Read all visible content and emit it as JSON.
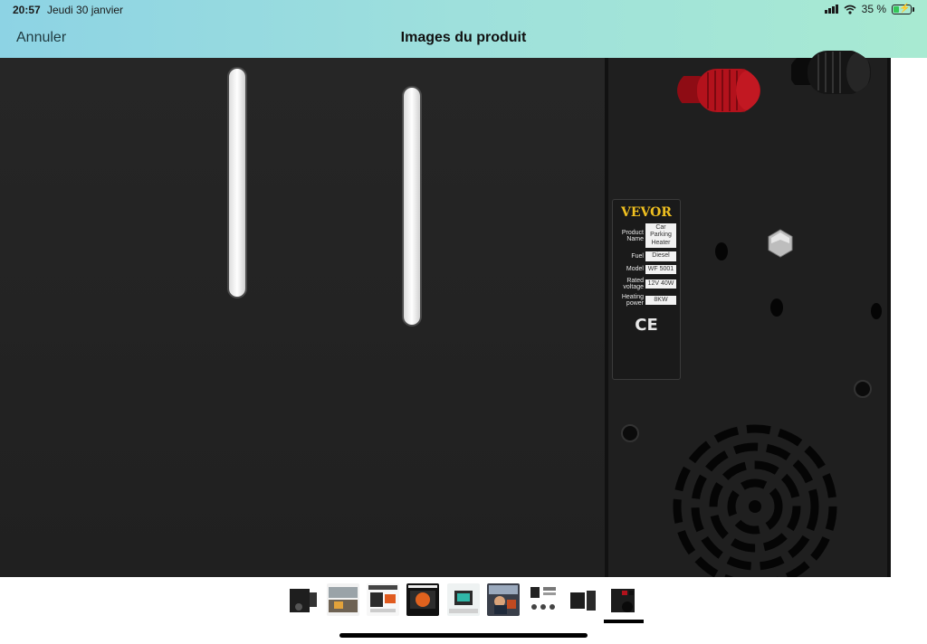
{
  "status_bar": {
    "time": "20:57",
    "date": "Jeudi 30 janvier",
    "battery": "35 %",
    "battery_level": 0.35
  },
  "nav": {
    "cancel_label": "Annuler",
    "title": "Images du produit"
  },
  "product_label": {
    "brand": "VEVOR",
    "specs": [
      {
        "key": "Product Name",
        "value": "Car Parking Heater"
      },
      {
        "key": "Fuel",
        "value": "Diesel"
      },
      {
        "key": "Model",
        "value": "WF 5001"
      },
      {
        "key": "Rated voltage",
        "value": "12V  40W"
      },
      {
        "key": "Heating power",
        "value": "8KW"
      }
    ],
    "mark": "CE"
  },
  "thumbnails": {
    "count": 9,
    "selected_index": 8
  },
  "icons": [
    "wifi-icon",
    "signal-icon",
    "battery-icon",
    "charging-bolt-icon"
  ],
  "colors": {
    "header_start": "#8dd3e4",
    "header_end": "#a8ead2",
    "brand_yellow": "#f0c020",
    "knob_red": "#b3121c"
  }
}
